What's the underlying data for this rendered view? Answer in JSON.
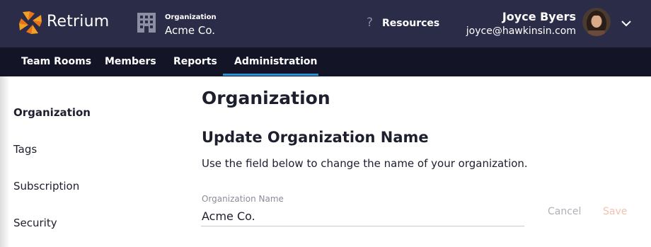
{
  "app": {
    "name": "Retrium"
  },
  "header": {
    "org_label": "Organization",
    "org_name": "Acme Co.",
    "resources_icon": "?",
    "resources_label": "Resources",
    "user_name": "Joyce Byers",
    "user_email": "joyce@hawkinsin.com"
  },
  "nav": {
    "items": [
      {
        "label": "Team Rooms"
      },
      {
        "label": "Members"
      },
      {
        "label": "Reports"
      },
      {
        "label": "Administration"
      }
    ],
    "active": "Administration"
  },
  "sidebar": {
    "items": [
      {
        "label": "Organization"
      },
      {
        "label": "Tags"
      },
      {
        "label": "Subscription"
      },
      {
        "label": "Security"
      }
    ],
    "active": "Organization"
  },
  "main": {
    "page_title": "Organization",
    "section_title": "Update Organization Name",
    "section_description": "Use the field below to change the name of your organization.",
    "field_label": "Organization Name",
    "field_value": "Acme Co.",
    "cancel_label": "Cancel",
    "save_label": "Save"
  },
  "colors": {
    "topbar": "#2b2c47",
    "navbar": "#131527",
    "nav_active_underline": "#2d8fd5",
    "logo_orange": "#f5a023",
    "save_disabled": "#f3c2b0"
  },
  "icons": {
    "logo": "retrium-logo-icon",
    "organization": "building-icon",
    "resources": "question-icon",
    "user_menu": "chevron-down-icon"
  }
}
